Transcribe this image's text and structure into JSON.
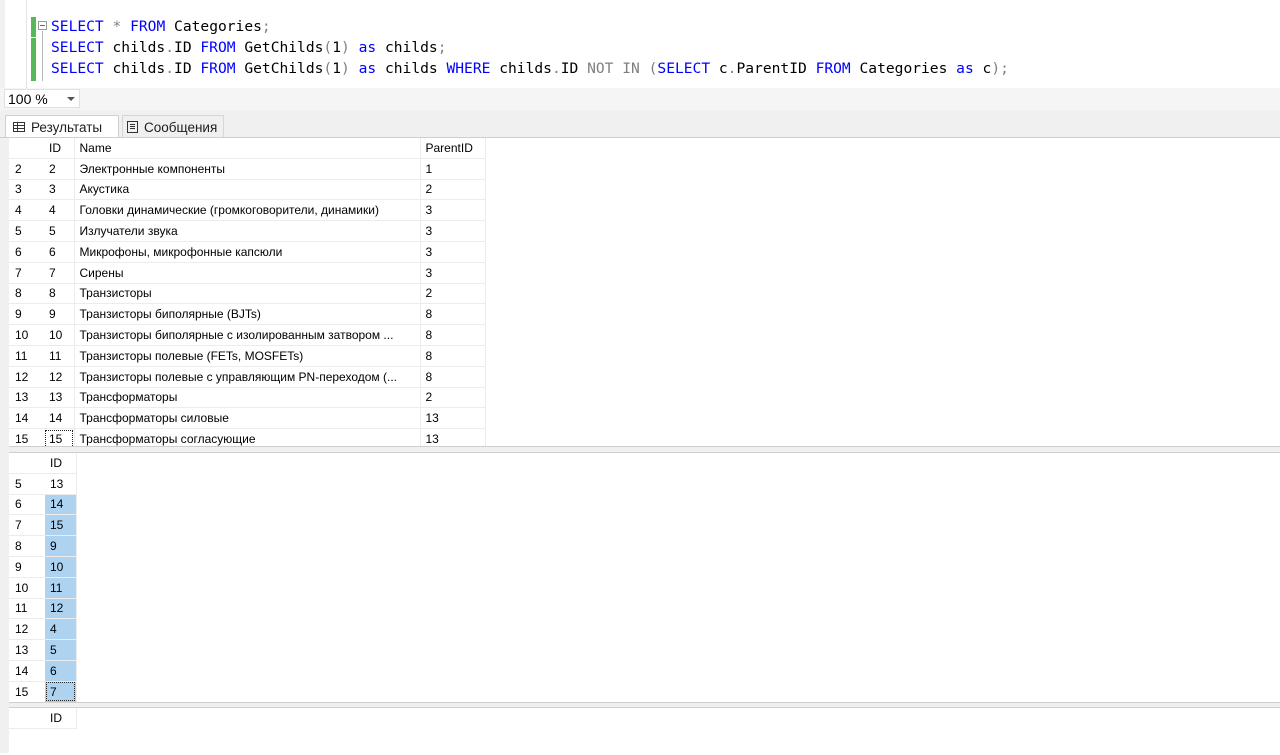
{
  "editor": {
    "lines": [
      [
        {
          "t": "SELECT",
          "c": "kw"
        },
        {
          "t": " ",
          "c": ""
        },
        {
          "t": "*",
          "c": "op"
        },
        {
          "t": " ",
          "c": ""
        },
        {
          "t": "FROM",
          "c": "kw"
        },
        {
          "t": " Categories",
          "c": ""
        },
        {
          "t": ";",
          "c": "op"
        }
      ],
      [
        {
          "t": "SELECT",
          "c": "kw"
        },
        {
          "t": " childs",
          "c": ""
        },
        {
          "t": ".",
          "c": "op"
        },
        {
          "t": "ID ",
          "c": ""
        },
        {
          "t": "FROM",
          "c": "kw"
        },
        {
          "t": " GetChilds",
          "c": ""
        },
        {
          "t": "(",
          "c": "op"
        },
        {
          "t": "1",
          "c": ""
        },
        {
          "t": ")",
          "c": "op"
        },
        {
          "t": " ",
          "c": ""
        },
        {
          "t": "as",
          "c": "kw"
        },
        {
          "t": " childs",
          "c": ""
        },
        {
          "t": ";",
          "c": "op"
        }
      ],
      [
        {
          "t": "SELECT",
          "c": "kw"
        },
        {
          "t": " childs",
          "c": ""
        },
        {
          "t": ".",
          "c": "op"
        },
        {
          "t": "ID ",
          "c": ""
        },
        {
          "t": "FROM",
          "c": "kw"
        },
        {
          "t": " GetChilds",
          "c": ""
        },
        {
          "t": "(",
          "c": "op"
        },
        {
          "t": "1",
          "c": ""
        },
        {
          "t": ")",
          "c": "op"
        },
        {
          "t": " ",
          "c": ""
        },
        {
          "t": "as",
          "c": "kw"
        },
        {
          "t": " childs ",
          "c": ""
        },
        {
          "t": "WHERE",
          "c": "kw"
        },
        {
          "t": " childs",
          "c": ""
        },
        {
          "t": ".",
          "c": "op"
        },
        {
          "t": "ID ",
          "c": ""
        },
        {
          "t": "NOT IN",
          "c": "op"
        },
        {
          "t": " ",
          "c": ""
        },
        {
          "t": "(",
          "c": "op"
        },
        {
          "t": "SELECT",
          "c": "kw"
        },
        {
          "t": " c",
          "c": ""
        },
        {
          "t": ".",
          "c": "op"
        },
        {
          "t": "ParentID ",
          "c": ""
        },
        {
          "t": "FROM",
          "c": "kw"
        },
        {
          "t": " Categories ",
          "c": ""
        },
        {
          "t": "as",
          "c": "kw"
        },
        {
          "t": " c",
          "c": ""
        },
        {
          "t": ");",
          "c": "op"
        }
      ]
    ]
  },
  "zoom": {
    "value": "100 %"
  },
  "tabs": {
    "results": "Результаты",
    "messages": "Сообщения"
  },
  "result1": {
    "headers": [
      "ID",
      "Name",
      "ParentID"
    ],
    "rows": [
      {
        "rn": "2",
        "id": "2",
        "name": "Электронные компоненты",
        "parent": "1"
      },
      {
        "rn": "3",
        "id": "3",
        "name": "Акустика",
        "parent": "2"
      },
      {
        "rn": "4",
        "id": "4",
        "name": "Головки динамические (громкоговорители, динамики)",
        "parent": "3"
      },
      {
        "rn": "5",
        "id": "5",
        "name": "Излучатели звука",
        "parent": "3"
      },
      {
        "rn": "6",
        "id": "6",
        "name": "Микрофоны, микрофонные капсюли",
        "parent": "3"
      },
      {
        "rn": "7",
        "id": "7",
        "name": "Сирены",
        "parent": "3"
      },
      {
        "rn": "8",
        "id": "8",
        "name": "Транзисторы",
        "parent": "2"
      },
      {
        "rn": "9",
        "id": "9",
        "name": "Транзисторы биполярные (BJTs)",
        "parent": "8"
      },
      {
        "rn": "10",
        "id": "10",
        "name": "Транзисторы биполярные с изолированным затвором ...",
        "parent": "8"
      },
      {
        "rn": "11",
        "id": "11",
        "name": "Транзисторы полевые (FETs, MOSFETs)",
        "parent": "8"
      },
      {
        "rn": "12",
        "id": "12",
        "name": "Транзисторы полевые с управляющим PN-переходом (...",
        "parent": "8"
      },
      {
        "rn": "13",
        "id": "13",
        "name": "Трансформаторы",
        "parent": "2"
      },
      {
        "rn": "14",
        "id": "14",
        "name": "Трансформаторы силовые",
        "parent": "13"
      },
      {
        "rn": "15",
        "id": "15",
        "name": "Трансформаторы согласующие",
        "parent": "13"
      }
    ]
  },
  "result2": {
    "headers": [
      "ID"
    ],
    "rows": [
      {
        "rn": "5",
        "id": "13"
      },
      {
        "rn": "6",
        "id": "14"
      },
      {
        "rn": "7",
        "id": "15"
      },
      {
        "rn": "8",
        "id": "9"
      },
      {
        "rn": "9",
        "id": "10"
      },
      {
        "rn": "10",
        "id": "11"
      },
      {
        "rn": "11",
        "id": "12"
      },
      {
        "rn": "12",
        "id": "4"
      },
      {
        "rn": "13",
        "id": "5"
      },
      {
        "rn": "14",
        "id": "6"
      },
      {
        "rn": "15",
        "id": "7"
      }
    ]
  },
  "result3": {
    "headers": [
      "ID"
    ]
  }
}
